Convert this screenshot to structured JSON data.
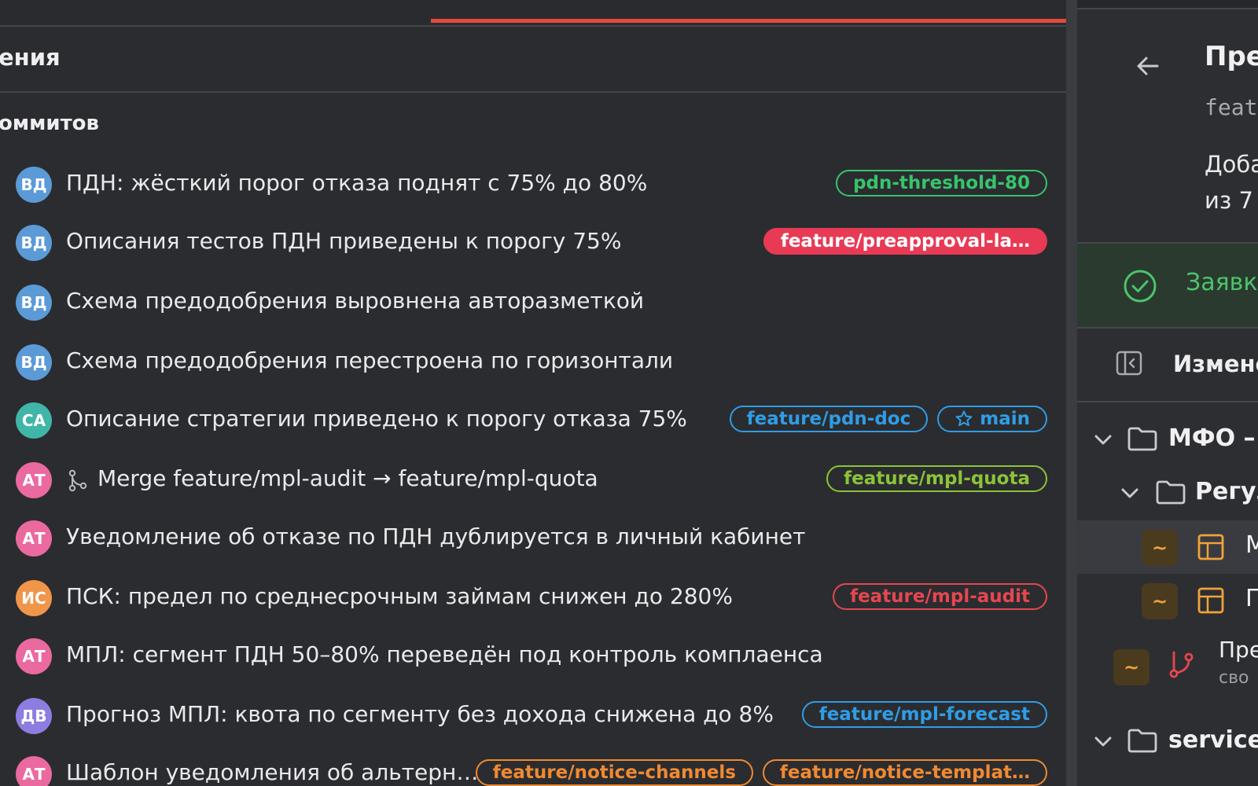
{
  "left": {
    "section_title": "ения",
    "commits_title": "оммитов",
    "commits": [
      {
        "avatar": "ВД",
        "avatar_color": "#5b9ad6",
        "message": "ПДН: жёсткий порог отказа поднят с 75% до 80%",
        "merge": false,
        "tags": [
          {
            "label": "pdn-threshold-80",
            "style": "outline",
            "color": "#37c46b"
          }
        ]
      },
      {
        "avatar": "ВД",
        "avatar_color": "#5b9ad6",
        "message": "Описания тестов ПДН приведены к порогу 75%",
        "merge": false,
        "tags": [
          {
            "label": "feature/preapproval-la…",
            "style": "filled",
            "color": "#e83a55"
          }
        ]
      },
      {
        "avatar": "ВД",
        "avatar_color": "#5b9ad6",
        "message": "Схема предодобрения выровнена авторазметкой",
        "merge": false,
        "tags": []
      },
      {
        "avatar": "ВД",
        "avatar_color": "#5b9ad6",
        "message": "Схема предодобрения перестроена по горизонтали",
        "merge": false,
        "tags": []
      },
      {
        "avatar": "СА",
        "avatar_color": "#3fb6a7",
        "message": "Описание стратегии приведено к порогу отказа 75%",
        "merge": false,
        "tags": [
          {
            "label": "feature/pdn-doc",
            "style": "outline",
            "color": "#2f9de6"
          },
          {
            "label": "main",
            "style": "outline",
            "color": "#2f9de6",
            "icon": "star-icon"
          }
        ]
      },
      {
        "avatar": "АТ",
        "avatar_color": "#ea6aa0",
        "message": "Merge feature/mpl-audit → feature/mpl-quota",
        "merge": true,
        "tags": [
          {
            "label": "feature/mpl-quota",
            "style": "outline",
            "color": "#8bc437"
          }
        ]
      },
      {
        "avatar": "АТ",
        "avatar_color": "#ea6aa0",
        "message": "Уведомление об отказе по ПДН дублируется в личный кабинет",
        "merge": false,
        "tags": []
      },
      {
        "avatar": "ИС",
        "avatar_color": "#f0964a",
        "message": "ПСК: предел по среднесрочным займам снижен до 280%",
        "merge": false,
        "tags": [
          {
            "label": "feature/mpl-audit",
            "style": "outline",
            "color": "#e5474f"
          }
        ]
      },
      {
        "avatar": "АТ",
        "avatar_color": "#ea6aa0",
        "message": "МПЛ: сегмент ПДН 50–80% переведён под контроль комплаенса",
        "merge": false,
        "tags": []
      },
      {
        "avatar": "ДВ",
        "avatar_color": "#8d7de0",
        "message": "Прогноз МПЛ: квота по сегменту без дохода снижена до 8%",
        "merge": false,
        "tags": [
          {
            "label": "feature/mpl-forecast",
            "style": "outline",
            "color": "#2f9de6"
          }
        ]
      },
      {
        "avatar": "АТ",
        "avatar_color": "#ea6aa0",
        "message": "Шаблон уведомления об альтерн…",
        "merge": false,
        "tags": [
          {
            "label": "feature/notice-channels",
            "style": "outline",
            "color": "#f08a30"
          },
          {
            "label": "feature/notice-templat…",
            "style": "outline",
            "color": "#f08a30"
          }
        ]
      }
    ]
  },
  "right": {
    "title": "Пре",
    "branch": "feat",
    "description": "Доба\nиз 7",
    "success_text": "Заявк",
    "changes_label": "Измене",
    "tree": [
      {
        "label": "МФО –",
        "kind": "folder"
      },
      {
        "label": "Регул",
        "kind": "folder"
      },
      {
        "label": "М",
        "kind": "file",
        "badge": "~"
      },
      {
        "label": "Г",
        "kind": "file",
        "badge": "~"
      },
      {
        "label": "Пре",
        "sublabel": "сво",
        "kind": "branch",
        "badge": "~"
      },
      {
        "label": "service",
        "kind": "folder"
      }
    ]
  }
}
